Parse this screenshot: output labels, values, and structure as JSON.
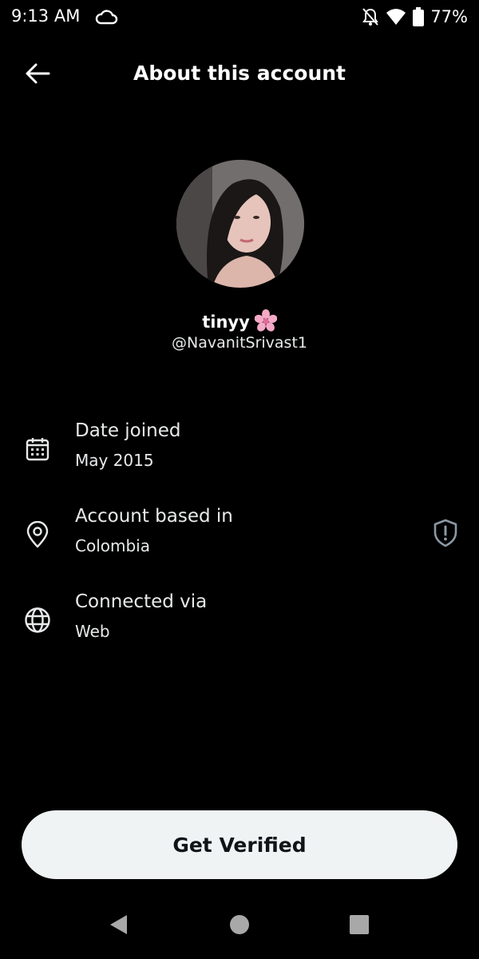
{
  "status_bar": {
    "time": "9:13 AM",
    "battery": "77%",
    "icons": [
      "cloud-icon",
      "notifications-off-icon",
      "wifi-icon",
      "battery-icon"
    ]
  },
  "header": {
    "title": "About this account",
    "back_icon": "arrow-left-icon"
  },
  "profile": {
    "display_name": "tinyy",
    "name_emoji": "cherry-blossom-icon",
    "handle": "@NavanitSrivast1"
  },
  "info": {
    "date_joined": {
      "title": "Date joined",
      "value": "May 2015",
      "icon": "calendar-icon"
    },
    "account_based": {
      "title": "Account based in",
      "value": "Colombia",
      "icon": "location-pin-icon",
      "action_icon": "shield-alert-icon"
    },
    "connected_via": {
      "title": "Connected via",
      "value": "Web",
      "icon": "globe-icon"
    }
  },
  "actions": {
    "verify_label": "Get Verified"
  },
  "nav_bar": {
    "icons": [
      "back-triangle-icon",
      "home-circle-icon",
      "recents-square-icon"
    ]
  },
  "colors": {
    "background": "#000000",
    "text": "#e7e9ea",
    "button_bg": "#eff3f4",
    "button_text": "#0f1419"
  }
}
